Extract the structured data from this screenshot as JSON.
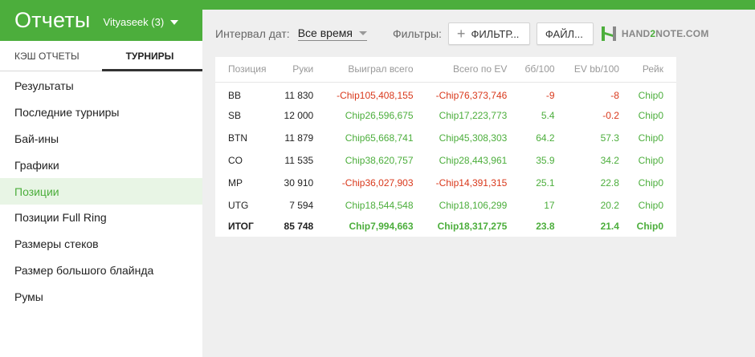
{
  "app": {
    "title": "Отчеты",
    "user": "Vityaseek (3)"
  },
  "sidebar": {
    "tabs": [
      "КЭШ ОТЧЕТЫ",
      "ТУРНИРЫ"
    ],
    "active_tab": "ТУРНИРЫ",
    "items": [
      {
        "label": "Результаты"
      },
      {
        "label": "Последние турниры"
      },
      {
        "label": "Бай-ины"
      },
      {
        "label": "Графики"
      },
      {
        "label": "Позиции",
        "active": true
      },
      {
        "label": "Позиции Full Ring"
      },
      {
        "label": "Размеры стеков"
      },
      {
        "label": "Размер большого блайнда"
      },
      {
        "label": "Румы"
      }
    ]
  },
  "toolbar": {
    "interval_label": "Интервал дат:",
    "interval_value": "Все время",
    "filters_label": "Фильтры:",
    "filters_button": "ФИЛЬТР...",
    "file_button": "ФАЙЛ...",
    "logo_hand": "HAND",
    "logo_two": "2",
    "logo_note": "NOTE.COM"
  },
  "table": {
    "headers": [
      "Позиция",
      "Руки",
      "Выиграл всего",
      "Всего по EV",
      "бб/100",
      "EV bb/100",
      "Рейк"
    ],
    "rows": [
      [
        "BB",
        "11 830",
        "-Chip105,408,155",
        "-Chip76,373,746",
        "-9",
        "-8",
        "Chip0"
      ],
      [
        "SB",
        "12 000",
        "Chip26,596,675",
        "Chip17,223,773",
        "5.4",
        "-0.2",
        "Chip0"
      ],
      [
        "BTN",
        "11 879",
        "Chip65,668,741",
        "Chip45,308,303",
        "64.2",
        "57.3",
        "Chip0"
      ],
      [
        "CO",
        "11 535",
        "Chip38,620,757",
        "Chip28,443,961",
        "35.9",
        "34.2",
        "Chip0"
      ],
      [
        "MP",
        "30 910",
        "-Chip36,027,903",
        "-Chip14,391,315",
        "25.1",
        "22.8",
        "Chip0"
      ],
      [
        "UTG",
        "7 594",
        "Chip18,544,548",
        "Chip18,106,299",
        "17",
        "20.2",
        "Chip0"
      ]
    ],
    "total": [
      "ИТОГ",
      "85 748",
      "Chip7,994,663",
      "Chip18,317,275",
      "23.8",
      "21.4",
      "Chip0"
    ]
  },
  "colors": {
    "accent": "#4cae3c",
    "negative": "#d9391c"
  }
}
